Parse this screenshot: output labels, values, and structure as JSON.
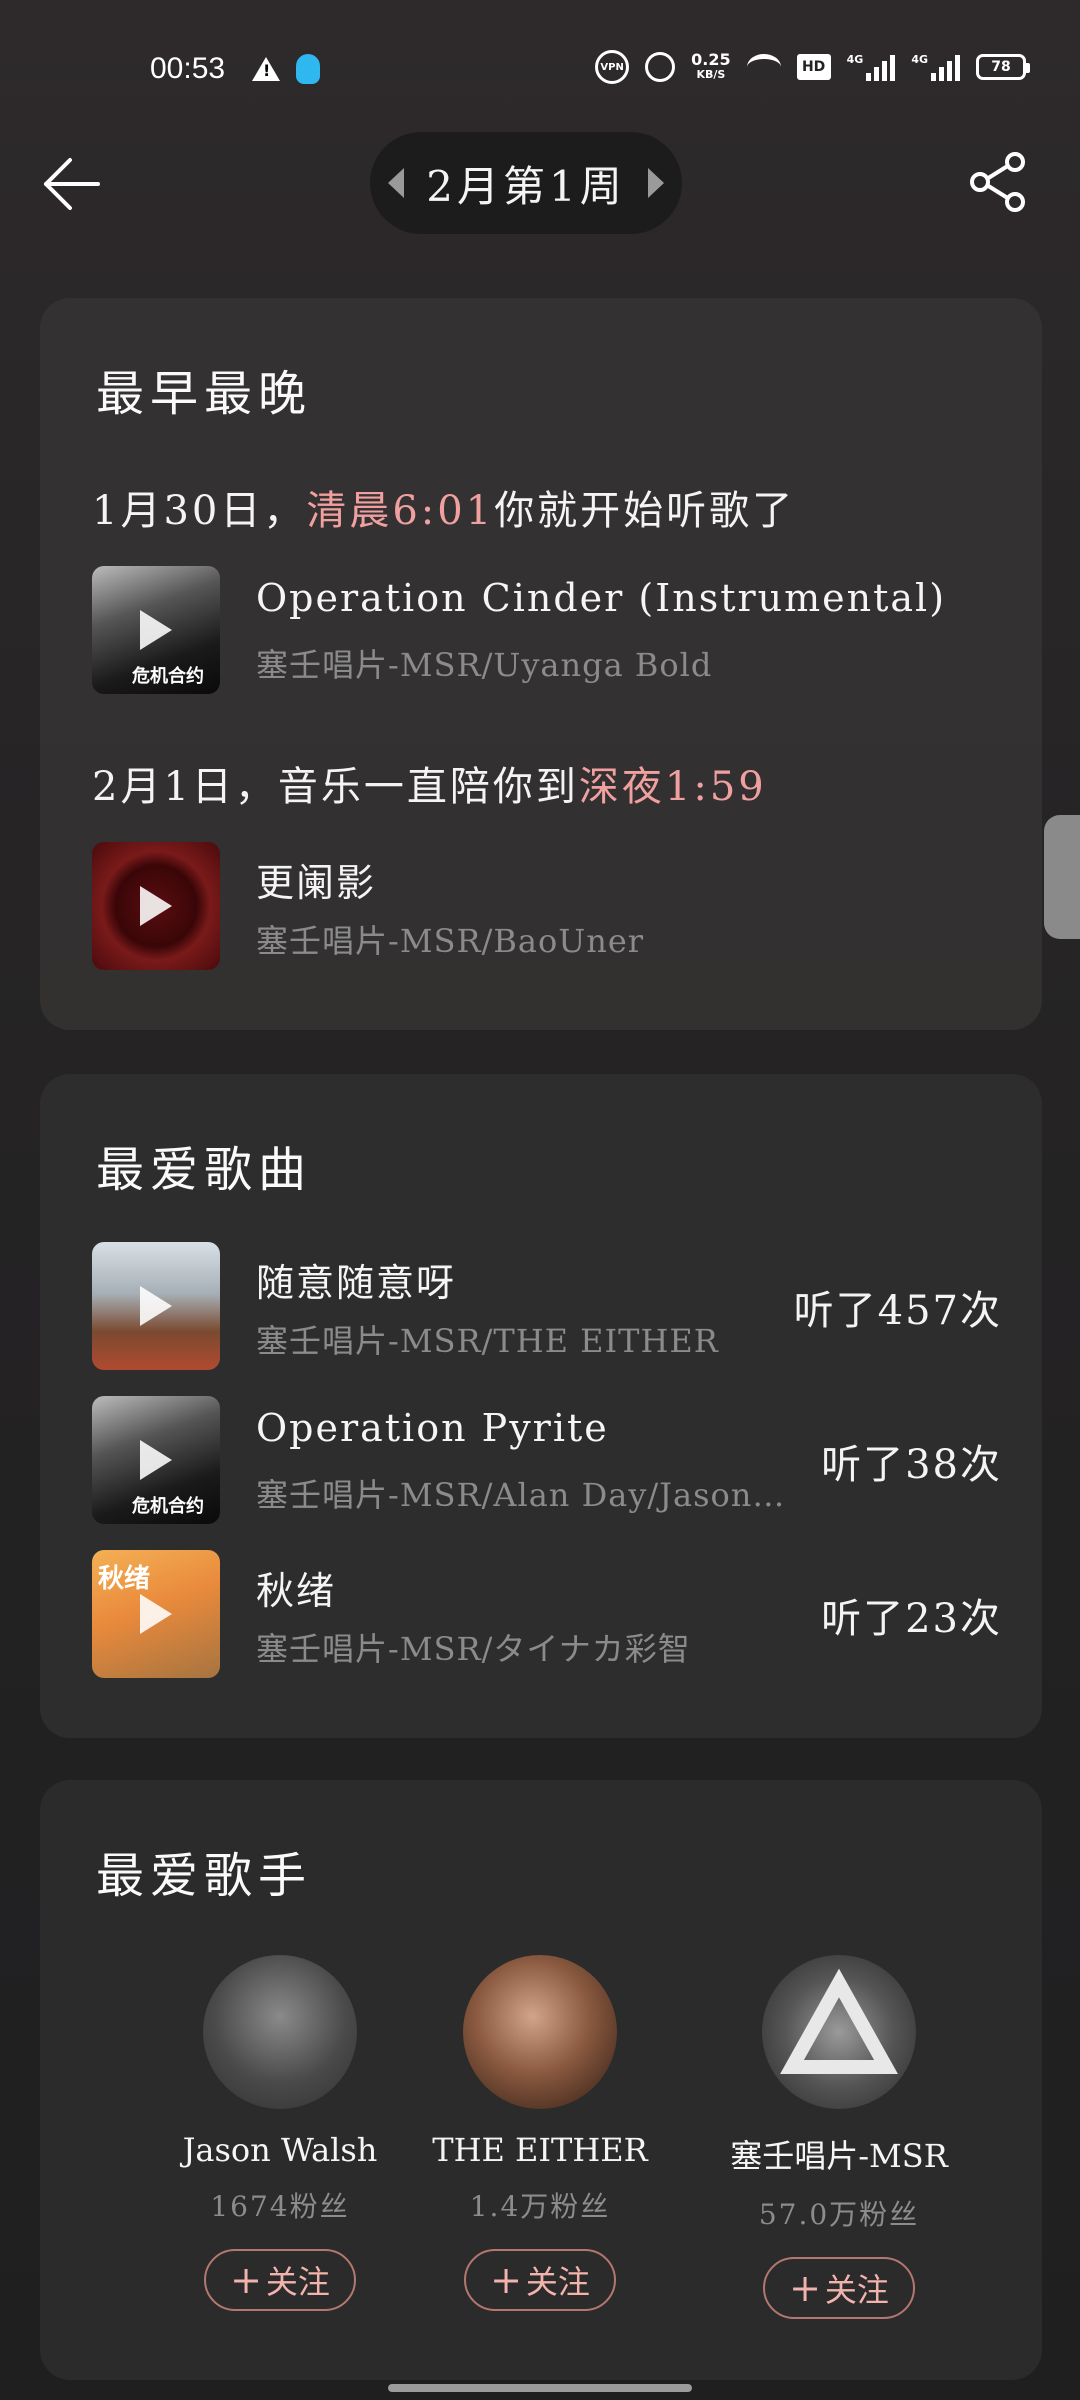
{
  "status_bar": {
    "time": "00:53",
    "net_speed_value": "0.25",
    "net_speed_unit": "KB/S",
    "vpn": "VPN",
    "hd": "HD",
    "sim1": "4G",
    "sim2": "4G",
    "battery": "78"
  },
  "header": {
    "week": "2月第1周"
  },
  "earliest_latest": {
    "title": "最早最晚",
    "early": {
      "date": "1月30日，",
      "highlight": "清晨6:01",
      "suffix": "你就开始听歌了",
      "song": {
        "title": "Operation Cinder (Instrumental)",
        "artist": "塞壬唱片-MSR/Uyanga Bold",
        "cover_text": "危机合约"
      }
    },
    "late": {
      "date": "2月1日，",
      "prefix": "音乐一直陪你到",
      "highlight": "深夜1:59",
      "song": {
        "title": "更阑影",
        "artist": "塞壬唱片-MSR/BaoUner"
      }
    }
  },
  "favorite_songs": {
    "title": "最爱歌曲",
    "items": [
      {
        "title": "随意随意呀",
        "artist": "塞壬唱片-MSR/THE EITHER",
        "count": "听了457次"
      },
      {
        "title": "Operation Pyrite",
        "artist": "塞壬唱片-MSR/Alan Day/Jason ...",
        "count": "听了38次",
        "cover_text": "危机合约"
      },
      {
        "title": "秋绪",
        "artist": "塞壬唱片-MSR/タイナカ彩智",
        "count": "听了23次",
        "cover_text": "秋绪"
      }
    ]
  },
  "favorite_artists": {
    "title": "最爱歌手",
    "follow_label": "关注",
    "items": [
      {
        "name": "Jason Walsh",
        "fans": "1674粉丝"
      },
      {
        "name": "THE EITHER",
        "fans": "1.4万粉丝"
      },
      {
        "name": "塞壬唱片-MSR",
        "fans": "57.0万粉丝"
      }
    ]
  },
  "colors": {
    "accent_pink": "#f1a0a0",
    "follow_border": "#b3776f"
  }
}
